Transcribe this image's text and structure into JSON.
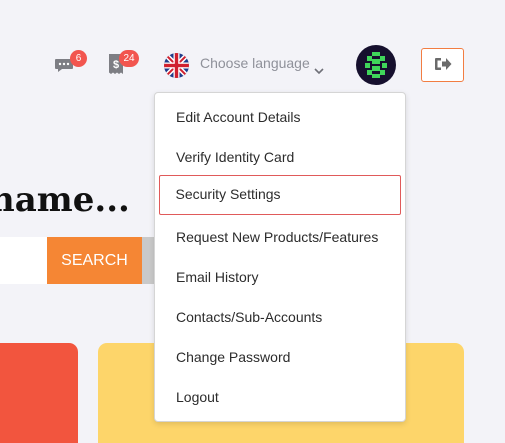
{
  "header": {
    "messages_badge": "6",
    "tasks_badge": "24",
    "language_label": "Choose language",
    "icons": {
      "messages": "chat-bubble-icon",
      "tasks": "receipt-dollar-icon",
      "language_flag": "uk-flag-icon",
      "dropdown": "chevron-down-icon",
      "logout": "sign-out-icon"
    },
    "accent_color": "#f27d42",
    "badge_color": "#f2554f"
  },
  "page": {
    "heading_fragment": "name...",
    "search_button": "SEARCH",
    "search_button_color": "#f58634",
    "card_colors": [
      "#f2553e",
      "#fdd56a"
    ]
  },
  "account_menu": {
    "items": [
      "Edit Account Details",
      "Verify Identity Card",
      "Security Settings",
      "Request New Products/Features",
      "Email History",
      "Contacts/Sub-Accounts",
      "Change Password",
      "Logout"
    ],
    "highlighted_item": "Security Settings"
  }
}
